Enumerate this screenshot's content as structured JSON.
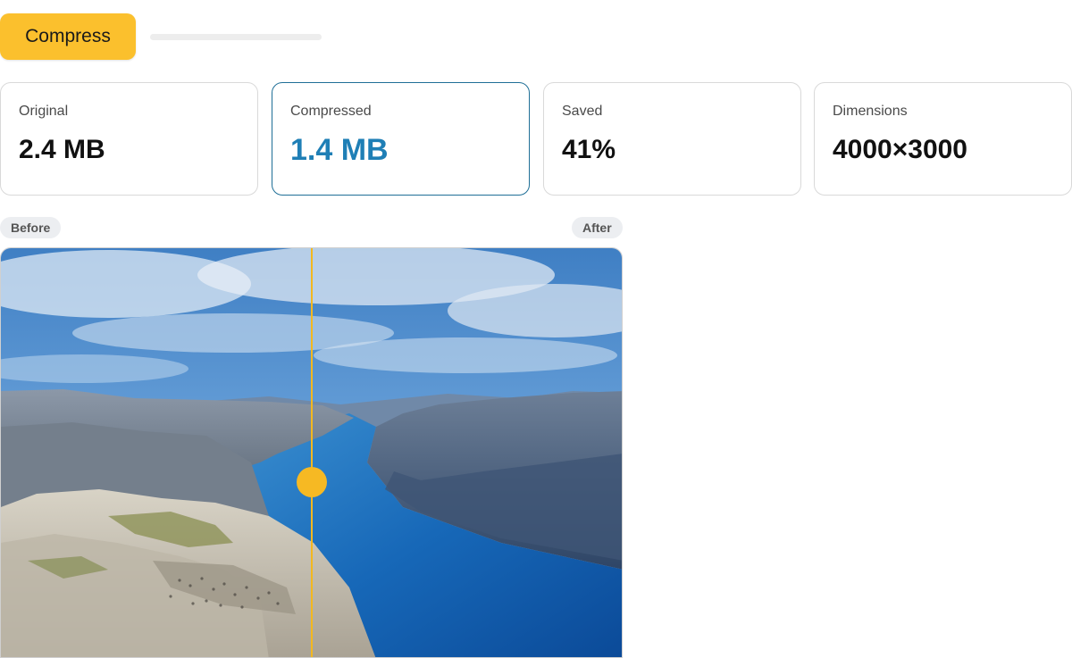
{
  "toolbar": {
    "compress_label": "Compress",
    "progress": 0
  },
  "stats": [
    {
      "label": "Original",
      "value": "2.4 MB"
    },
    {
      "label": "Compressed",
      "value": "1.4 MB"
    },
    {
      "label": "Saved",
      "value": "41%"
    },
    {
      "label": "Dimensions",
      "value": "4000×3000"
    }
  ],
  "compare": {
    "before_label": "Before",
    "after_label": "After",
    "split_fraction": 0.5
  },
  "colors": {
    "accent": "#fbc02d",
    "selected_border": "#1f6f97",
    "selected_value": "#1f7fb6"
  }
}
